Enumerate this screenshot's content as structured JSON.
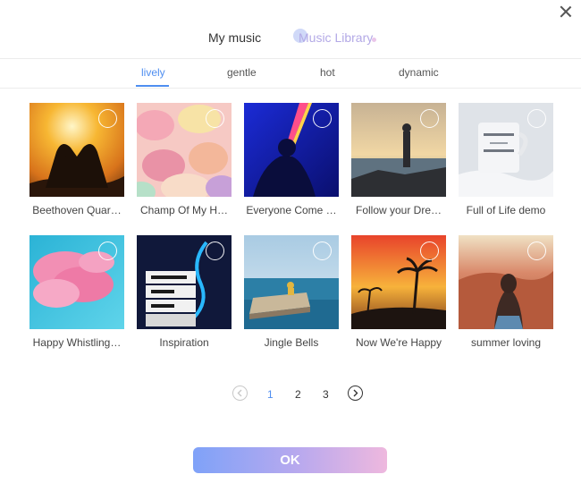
{
  "top_tabs": {
    "my_music": "My music",
    "music_library": "Music Library"
  },
  "categories": [
    "lively",
    "gentle",
    "hot",
    "dynamic"
  ],
  "active_category": "lively",
  "tracks": [
    {
      "title": "Beethoven Quar…",
      "thumbnail": "sunset-heart-hands"
    },
    {
      "title": "Champ Of My H…",
      "thumbnail": "candy-hearts"
    },
    {
      "title": "Everyone Come …",
      "thumbnail": "neon-blue-figure"
    },
    {
      "title": "Follow your Dre…",
      "thumbnail": "man-on-rocks-sunset"
    },
    {
      "title": "Full of Life demo",
      "thumbnail": "have-a-dream-mug"
    },
    {
      "title": "Happy Whistling…",
      "thumbnail": "pink-clouds"
    },
    {
      "title": "Inspiration",
      "thumbnail": "reach-for-the-lightbox"
    },
    {
      "title": "Jingle Bells",
      "thumbnail": "pier-by-sea"
    },
    {
      "title": "Now We're Happy",
      "thumbnail": "palm-sunset"
    },
    {
      "title": "summer loving",
      "thumbnail": "woman-on-red-rocks"
    }
  ],
  "pagination": {
    "pages": [
      "1",
      "2",
      "3"
    ],
    "current": "1"
  },
  "ok_label": "OK",
  "colors": {
    "accent": "#4f8ef0",
    "ok_start": "#7fa2f8",
    "ok_end": "#eeb8de",
    "library_tab": "#b3a9e6"
  },
  "icons": {
    "close": "close-icon",
    "prev": "chevron-left-icon",
    "next": "chevron-right-icon",
    "select": "select-circle-icon"
  }
}
